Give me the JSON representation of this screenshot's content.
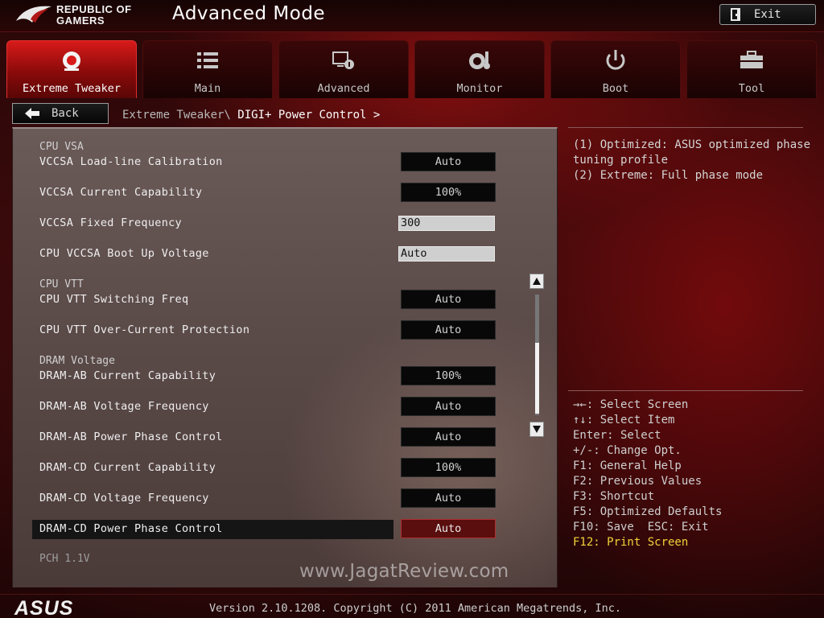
{
  "header": {
    "brand_line1": "REPUBLIC OF",
    "brand_line2": "GAMERS",
    "mode_title": "Advanced Mode",
    "exit_label": "Exit"
  },
  "tabs": [
    {
      "label": "Extreme Tweaker",
      "icon": "extreme-tweaker-icon",
      "active": true
    },
    {
      "label": "Main",
      "icon": "list-icon",
      "active": false
    },
    {
      "label": "Advanced",
      "icon": "advanced-settings-icon",
      "active": false
    },
    {
      "label": "Monitor",
      "icon": "monitor-gauge-icon",
      "active": false
    },
    {
      "label": "Boot",
      "icon": "power-icon",
      "active": false
    },
    {
      "label": "Tool",
      "icon": "toolbox-icon",
      "active": false
    }
  ],
  "nav": {
    "back_label": "Back",
    "breadcrumb_parent": "Extreme Tweaker\\",
    "breadcrumb_current": "DIGI+ Power Control >"
  },
  "settings": {
    "group_cpu_vsa": "CPU VSA",
    "vccsa_llc_label": "VCCSA Load-line Calibration",
    "vccsa_llc_value": "Auto",
    "vccsa_current_label": "VCCSA Current Capability",
    "vccsa_current_value": "100%",
    "vccsa_freq_label": "VCCSA Fixed Frequency",
    "vccsa_freq_value": "300",
    "vccsa_boot_label": "CPU VCCSA Boot Up Voltage",
    "vccsa_boot_value": "Auto",
    "group_cpu_vtt": "CPU VTT",
    "vtt_switch_label": "CPU VTT Switching Freq",
    "vtt_switch_value": "Auto",
    "vtt_ocp_label": "CPU VTT Over-Current Protection",
    "vtt_ocp_value": "Auto",
    "group_dram": "DRAM Voltage",
    "dram_ab_current_label": "DRAM-AB Current Capability",
    "dram_ab_current_value": "100%",
    "dram_ab_freq_label": "DRAM-AB Voltage Frequency",
    "dram_ab_freq_value": "Auto",
    "dram_ab_phase_label": "DRAM-AB Power Phase Control",
    "dram_ab_phase_value": "Auto",
    "dram_cd_current_label": "DRAM-CD Current Capability",
    "dram_cd_current_value": "100%",
    "dram_cd_freq_label": "DRAM-CD Voltage Frequency",
    "dram_cd_freq_value": "Auto",
    "dram_cd_phase_label": "DRAM-CD Power Phase Control",
    "dram_cd_phase_value": "Auto",
    "group_pch": "PCH 1.1V"
  },
  "watermark": "www.JagatReview.com",
  "help": {
    "line1": "(1) Optimized: ASUS optimized phase",
    "line2": "tuning profile",
    "line3": "(2) Extreme: Full phase mode"
  },
  "keys": {
    "select_screen": "→←: Select Screen",
    "select_item": "↑↓: Select Item",
    "enter": "Enter: Select",
    "change": "+/-: Change Opt.",
    "f1": "F1: General Help",
    "f2": "F2: Previous Values",
    "f3": "F3: Shortcut",
    "f5": "F5: Optimized Defaults",
    "f10_esc": "F10: Save  ESC: Exit",
    "f12": "F12: Print Screen"
  },
  "footer": {
    "brand": "ASUS",
    "version": "Version 2.10.1208. Copyright (C) 2011 American Megatrends, Inc."
  },
  "colors": {
    "accent_red": "#d81a1a",
    "highlight_yellow": "#f3d23a",
    "selected_value_bg": "#5a0e0e"
  }
}
